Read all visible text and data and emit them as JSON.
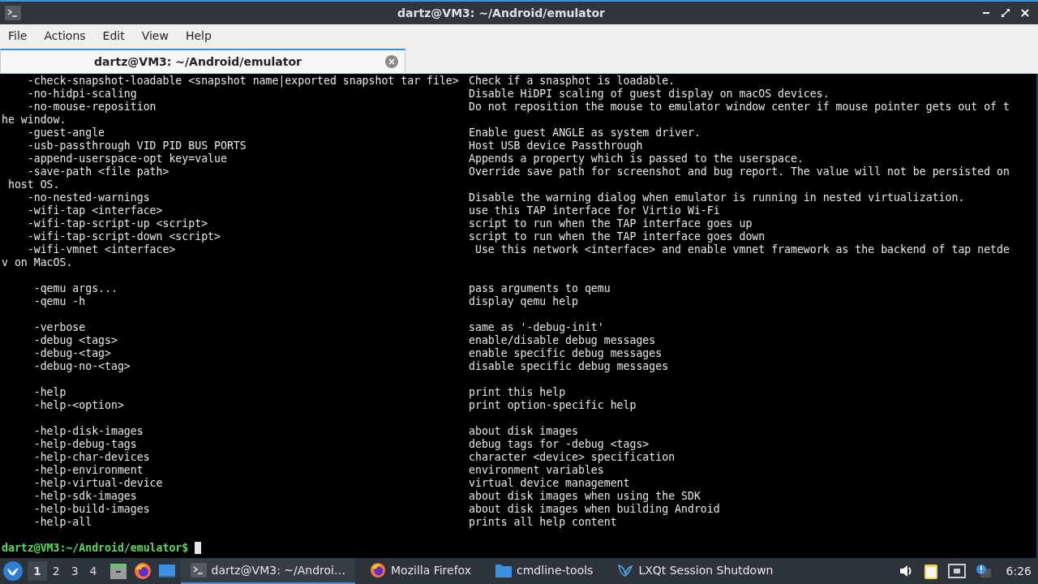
{
  "window": {
    "title": "dartz@VM3: ~/Android/emulator"
  },
  "menu": [
    "File",
    "Actions",
    "Edit",
    "View",
    "Help"
  ],
  "tabs": [
    {
      "label": "dartz@VM3: ~/Android/emulator",
      "selected": true
    }
  ],
  "terminal": {
    "sections": [
      {
        "lines": [
          {
            "option": "    -check-snapshot-loadable <snapshot name|exported snapshot tar file>",
            "description": "Check if a snasphot is loadable."
          },
          {
            "option": "    -no-hidpi-scaling",
            "description": "Disable HiDPI scaling of guest display on macOS devices."
          },
          {
            "option": "    -no-mouse-reposition",
            "description": "Do not reposition the mouse to emulator window center if mouse pointer gets out of t"
          },
          {
            "text": "he window."
          },
          {
            "option": "    -guest-angle",
            "description": "Enable guest ANGLE as system driver."
          },
          {
            "option": "    -usb-passthrough VID PID BUS PORTS",
            "description": "Host USB device Passthrough"
          },
          {
            "option": "    -append-userspace-opt key=value",
            "description": "Appends a property which is passed to the userspace."
          },
          {
            "option": "    -save-path <file path>",
            "description": "Override save path for screenshot and bug report. The value will not be persisted on"
          },
          {
            "text": " host OS."
          },
          {
            "option": "    -no-nested-warnings",
            "description": "Disable the warning dialog when emulator is running in nested virtualization."
          },
          {
            "option": "    -wifi-tap <interface>",
            "description": "use this TAP interface for Virtio Wi-Fi"
          },
          {
            "option": "    -wifi-tap-script-up <script>",
            "description": "script to run when the TAP interface goes up"
          },
          {
            "option": "    -wifi-tap-script-down <script>",
            "description": "script to run when the TAP interface goes down"
          },
          {
            "option": "    -wifi-vmnet <interface>",
            "description": " Use this network <interface> and enable vmnet framework as the backend of tap netde"
          },
          {
            "text": "v on MacOS."
          }
        ]
      },
      {
        "lines": [
          {
            "option": "     -qemu args...",
            "description": "pass arguments to qemu"
          },
          {
            "option": "     -qemu -h",
            "description": "display qemu help"
          }
        ]
      },
      {
        "lines": [
          {
            "option": "     -verbose",
            "description": "same as '-debug-init'"
          },
          {
            "option": "     -debug <tags>",
            "description": "enable/disable debug messages"
          },
          {
            "option": "     -debug-<tag>",
            "description": "enable specific debug messages"
          },
          {
            "option": "     -debug-no-<tag>",
            "description": "disable specific debug messages"
          }
        ]
      },
      {
        "lines": [
          {
            "option": "     -help",
            "description": "print this help"
          },
          {
            "option": "     -help-<option>",
            "description": "print option-specific help"
          }
        ]
      },
      {
        "lines": [
          {
            "option": "     -help-disk-images",
            "description": "about disk images"
          },
          {
            "option": "     -help-debug-tags",
            "description": "debug tags for -debug <tags>"
          },
          {
            "option": "     -help-char-devices",
            "description": "character <device> specification"
          },
          {
            "option": "     -help-environment",
            "description": "environment variables"
          },
          {
            "option": "     -help-virtual-device",
            "description": "virtual device management"
          },
          {
            "option": "     -help-sdk-images",
            "description": "about disk images when using the SDK"
          },
          {
            "option": "     -help-build-images",
            "description": "about disk images when building Android"
          },
          {
            "option": "     -help-all",
            "description": "prints all help content"
          }
        ]
      }
    ],
    "prompt": "dartz@VM3:~/Android/emulator$"
  },
  "taskbar": {
    "desktops": [
      {
        "label": "1",
        "selected": true
      },
      {
        "label": "2",
        "selected": false
      },
      {
        "label": "3",
        "selected": false
      },
      {
        "label": "4",
        "selected": false
      }
    ],
    "tasks": [
      {
        "label": "dartz@VM3: ~/Androi…",
        "kind": "terminal",
        "selected": true
      },
      {
        "label": "Mozilla Firefox",
        "kind": "browser",
        "selected": false
      },
      {
        "label": "cmdline-tools",
        "kind": "folder",
        "selected": false
      },
      {
        "label": "LXQt Session Shutdown",
        "kind": "shutdown",
        "selected": false
      }
    ],
    "clock": "6:26"
  }
}
